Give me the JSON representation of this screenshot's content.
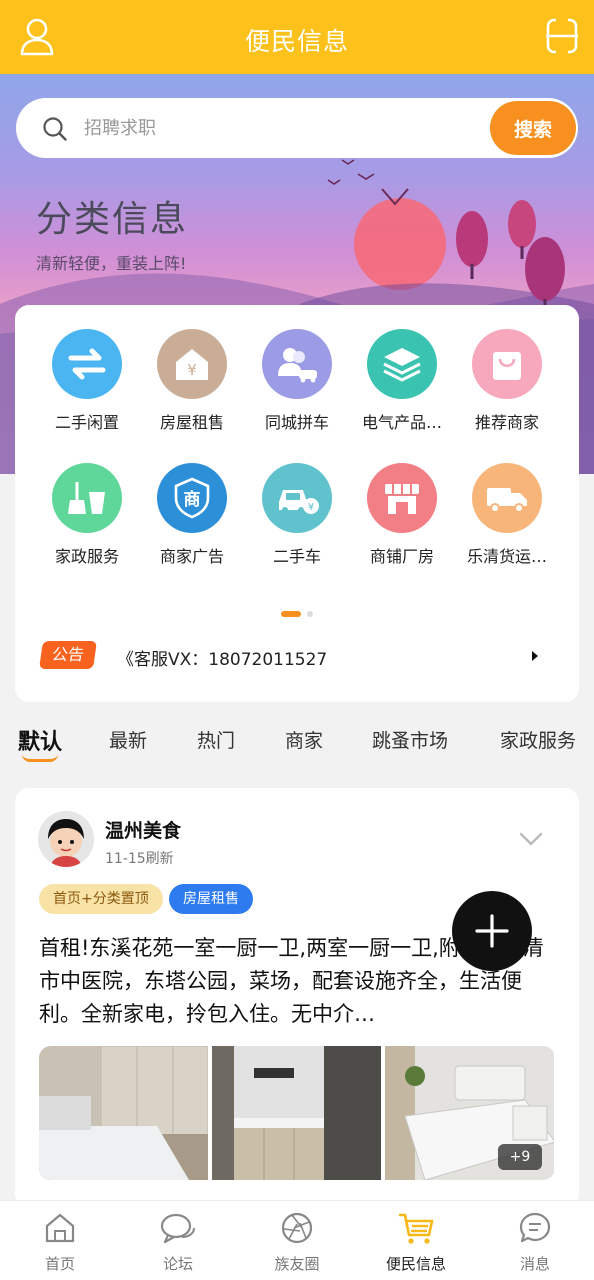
{
  "header": {
    "title": "便民信息",
    "left_icon": "user-icon",
    "right_icon": "menu-icon"
  },
  "search": {
    "placeholder": "招聘求职",
    "button_label": "搜索"
  },
  "banner": {
    "title": "分类信息",
    "subtitle": "清新轻便，重装上阵!"
  },
  "categories": [
    {
      "label": "二手闲置",
      "icon": "exchange-arrows-icon",
      "color": "#4ab5f0"
    },
    {
      "label": "房屋租售",
      "icon": "house-yuan-icon",
      "color": "#c9ad96"
    },
    {
      "label": "同城拼车",
      "icon": "carpool-icon",
      "color": "#9b9be6"
    },
    {
      "label": "电气产品…",
      "icon": "layers-icon",
      "color": "#39c3b0"
    },
    {
      "label": "推荐商家",
      "icon": "shopping-bag-icon",
      "color": "#f7a8bd"
    },
    {
      "label": "家政服务",
      "icon": "broom-bucket-icon",
      "color": "#5fd79b"
    },
    {
      "label": "商家广告",
      "icon": "shop-shield-icon",
      "color": "#2d8fd8"
    },
    {
      "label": "二手车",
      "icon": "car-yuan-icon",
      "color": "#5fc2cc"
    },
    {
      "label": "商铺厂房",
      "icon": "storefront-icon",
      "color": "#f27f86"
    },
    {
      "label": "乐清货运…",
      "icon": "truck-icon",
      "color": "#f7b57a"
    }
  ],
  "notice": {
    "badge": "公告",
    "text": "《客服VX：18072011527"
  },
  "tabs": [
    "默认",
    "最新",
    "热门",
    "商家",
    "跳蚤市场",
    "家政服务"
  ],
  "post": {
    "author": "温州美食",
    "time": "11-15刷新",
    "tag_top": "首页+分类置顶",
    "tag_category": "房屋租售",
    "content": "首租!东溪花苑一室一厨一卫,两室一厨一卫,附近有乐清市中医院，东塔公园，菜场，配套设施齐全，生活便利。全新家电，拎包入住。无中介…",
    "more_photos": "+9"
  },
  "bottom_nav": [
    {
      "label": "首页",
      "icon": "home-icon"
    },
    {
      "label": "论坛",
      "icon": "chat-bubble-icon"
    },
    {
      "label": "族友圈",
      "icon": "aperture-icon"
    },
    {
      "label": "便民信息",
      "icon": "cart-icon",
      "active": true
    },
    {
      "label": "消息",
      "icon": "message-icon"
    }
  ],
  "colors": {
    "brand_yellow": "#fcc21b",
    "accent_orange": "#f7901e",
    "tag_blue": "#2e7bef"
  }
}
